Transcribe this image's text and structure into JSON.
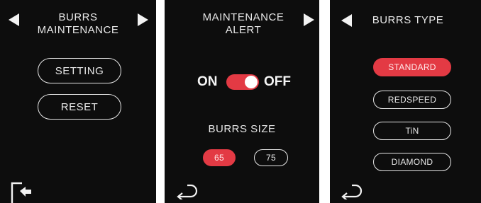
{
  "screens": [
    {
      "title_line1": "BURRS",
      "title_line2": "MAINTENANCE",
      "buttons": [
        "SETTING",
        "RESET"
      ],
      "icons": [
        "arrow-left-icon",
        "arrow-right-icon",
        "exit-icon"
      ]
    },
    {
      "title_line1": "MAINTENANCE",
      "title_line2": "ALERT",
      "toggle": {
        "on_label": "ON",
        "off_label": "OFF",
        "state": "on"
      },
      "size_label": "BURRS SIZE",
      "sizes": [
        "65",
        "75"
      ],
      "selected_size": "65",
      "icons": [
        "arrow-right-icon",
        "back-icon"
      ]
    },
    {
      "title": "BURRS TYPE",
      "options": [
        "STANDARD",
        "REDSPEED",
        "TiN",
        "DIAMOND"
      ],
      "selected_option": "STANDARD",
      "icons": [
        "arrow-left-icon",
        "back-icon"
      ]
    }
  ],
  "colors": {
    "accent": "#e33a44",
    "background": "#0d0d0d",
    "foreground": "#e6e6e6"
  }
}
